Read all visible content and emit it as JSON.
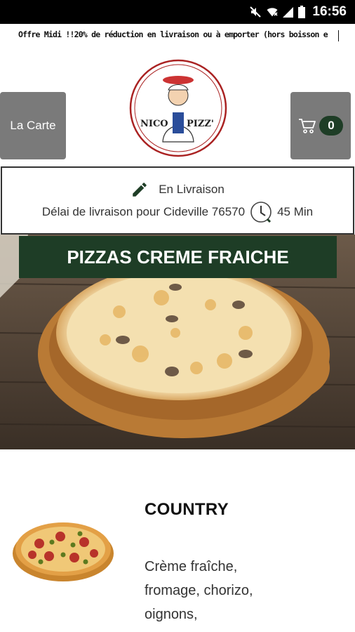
{
  "status_bar": {
    "time": "16:56",
    "icons": [
      "mute-icon",
      "wifi-icon",
      "signal-icon",
      "battery-icon"
    ]
  },
  "ticker": {
    "text": "Offre Midi !!20% de réduction en livraison ou à emporter (hors boisson e"
  },
  "header": {
    "menu_button_label": "La Carte",
    "cart_count": "0",
    "logo_text": "NICO PIZZ'"
  },
  "delivery": {
    "mode_label": "En Livraison",
    "info_text": "Délai de livraison pour Cideville 76570",
    "time_label": "45 Min"
  },
  "category": {
    "title": "PIZZAS CREME FRAICHE"
  },
  "product": {
    "name": "COUNTRY",
    "description": "Crème fraîche, fromage, chorizo, oignons,"
  },
  "colors": {
    "accent_green": "#1e3d26",
    "button_grey": "#7a7a7a",
    "status_bar": "#000000"
  }
}
